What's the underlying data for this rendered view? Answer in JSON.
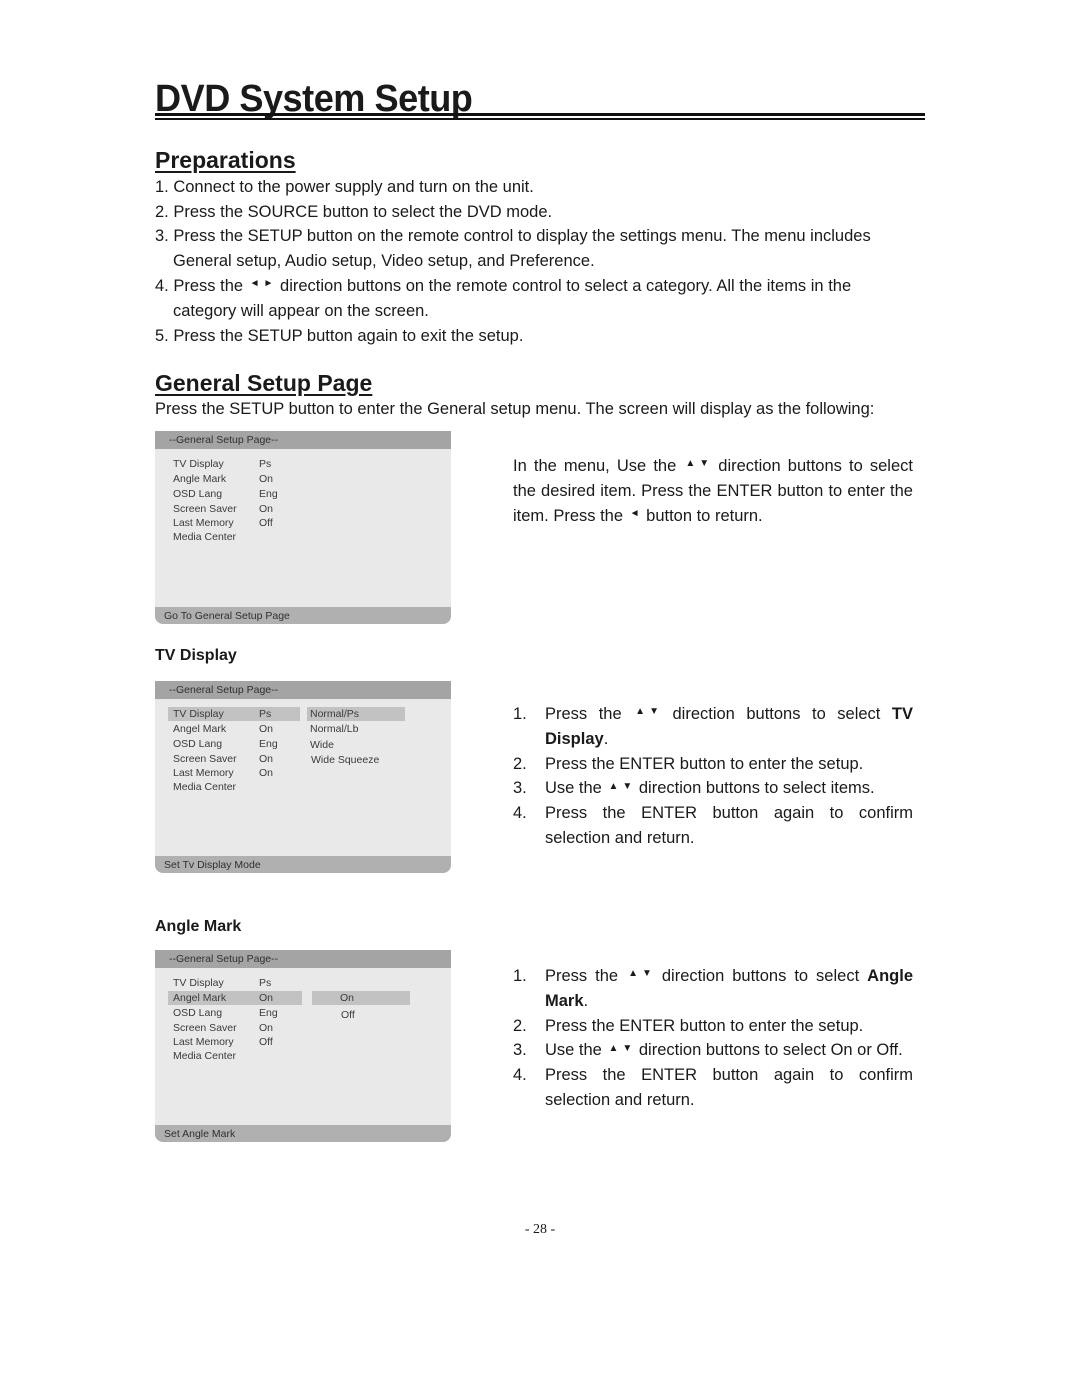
{
  "page": {
    "title": "DVD System Setup",
    "page_number": "- 28 -"
  },
  "preparations": {
    "heading": "Preparations",
    "steps": [
      {
        "text": "1. Connect to the power supply and turn on the unit."
      },
      {
        "text": "2. Press the SOURCE button to select the DVD mode."
      },
      {
        "text": "3. Press the SETUP button on the remote control to display the settings menu. The menu includes",
        "cont": "General setup, Audio setup, Video setup, and Preference."
      },
      {
        "pre": "4. Press the",
        "post": "direction buttons on the remote control to select a category. All the items in the",
        "cont": "category will appear on the screen."
      },
      {
        "text": "5. Press the SETUP button again to exit the setup."
      }
    ],
    "icons": {
      "left_arrow": "◄",
      "right_arrow": "►",
      "up_arrow": "▲",
      "down_arrow": "▼"
    }
  },
  "general_setup": {
    "heading": "General Setup Page",
    "intro": "Press the SETUP button to enter the General setup menu. The screen will display as the following:",
    "nav_text": {
      "part1": "In the menu, Use the",
      "part2": "direction buttons to select the desired item. Press the ENTER button to enter the item. Press the",
      "part3": "button to return."
    },
    "menu": {
      "header": "--General Setup Page--",
      "items": [
        {
          "label": "TV Display",
          "value": "Ps"
        },
        {
          "label": "Angle Mark",
          "value": "On"
        },
        {
          "label": "OSD Lang",
          "value": "Eng"
        },
        {
          "label": "Screen Saver",
          "value": "On"
        },
        {
          "label": "Last Memory",
          "value": "Off"
        },
        {
          "label": "Media Center",
          "value": ""
        }
      ],
      "footer": "Go To General Setup Page"
    }
  },
  "tv_display": {
    "heading": "TV Display",
    "menu": {
      "header": "--General Setup Page--",
      "items": [
        {
          "label": "TV Display",
          "value": "Ps"
        },
        {
          "label": "Angel Mark",
          "value": "On"
        },
        {
          "label": "OSD Lang",
          "value": "Eng"
        },
        {
          "label": "Screen Saver",
          "value": "On"
        },
        {
          "label": "Last Memory",
          "value": "On"
        },
        {
          "label": "Media Center",
          "value": ""
        }
      ],
      "options": [
        "Normal/Ps",
        "Normal/Lb",
        "Wide",
        "Wide Squeeze"
      ],
      "selected_item": "TV Display",
      "selected_option": "Normal/Ps",
      "footer": "Set Tv Display Mode"
    },
    "steps": [
      {
        "num": "1.",
        "pre": "Press the",
        "post": "direction buttons to select",
        "bold": "TV Display",
        "end": "."
      },
      {
        "num": "2.",
        "text": "Press the ENTER button to enter the setup."
      },
      {
        "num": "3.",
        "pre": "Use the",
        "post": "direction buttons to select items."
      },
      {
        "num": "4.",
        "text": "Press the ENTER button again to confirm selection and return."
      }
    ]
  },
  "angle_mark": {
    "heading": "Angle Mark",
    "menu": {
      "header": "--General Setup Page--",
      "items": [
        {
          "label": "TV Display",
          "value": "Ps"
        },
        {
          "label": "Angel Mark",
          "value": "On"
        },
        {
          "label": "OSD Lang",
          "value": "Eng"
        },
        {
          "label": "Screen Saver",
          "value": "On"
        },
        {
          "label": "Last Memory",
          "value": "Off"
        },
        {
          "label": "Media Center",
          "value": ""
        }
      ],
      "options": [
        "On",
        "Off"
      ],
      "selected_item": "Angel Mark",
      "selected_option": "On",
      "footer": "Set Angle Mark"
    },
    "steps": [
      {
        "num": "1.",
        "pre": "Press the",
        "post": "direction buttons to select",
        "bold": "Angle Mark",
        "end": "."
      },
      {
        "num": "2.",
        "text": "Press the ENTER button to enter the setup."
      },
      {
        "num": "3.",
        "pre": "Use the",
        "post": "direction buttons to select On or Off."
      },
      {
        "num": "4.",
        "text": "Press the ENTER button again to confirm selection and return."
      }
    ]
  }
}
